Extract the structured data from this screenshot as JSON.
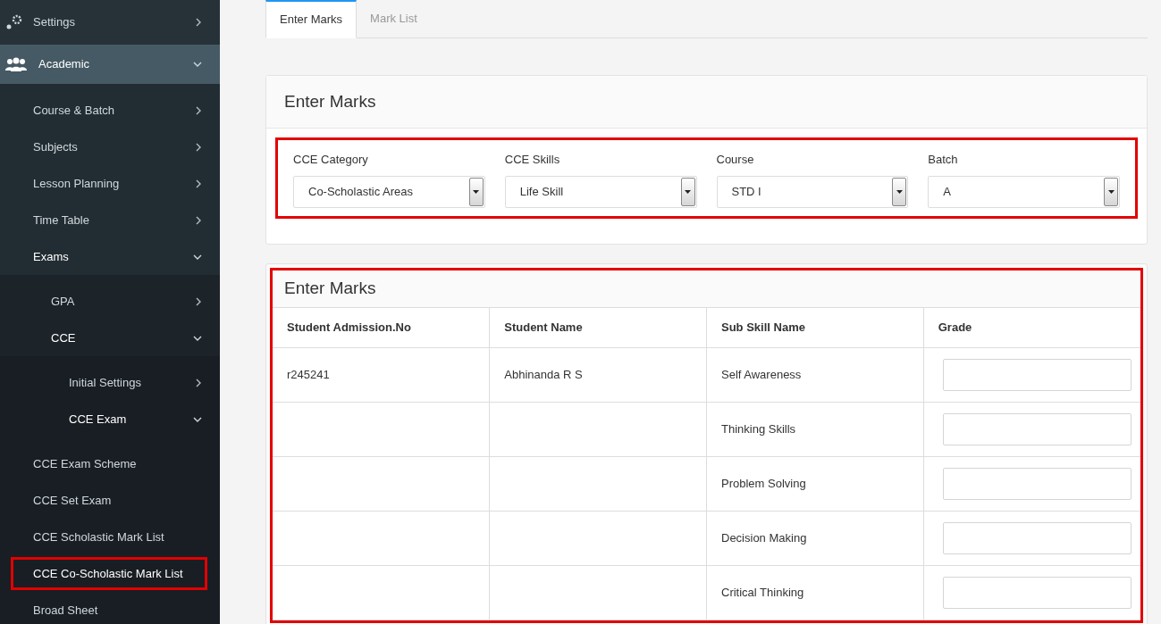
{
  "sidebar": {
    "items": [
      {
        "label": "Settings",
        "kind": "settings",
        "expanded": false
      },
      {
        "label": "Academic",
        "kind": "people",
        "expanded": true,
        "children": [
          {
            "label": "Course & Batch",
            "expanded": false
          },
          {
            "label": "Subjects",
            "expanded": false
          },
          {
            "label": "Lesson Planning",
            "expanded": false
          },
          {
            "label": "Time Table",
            "expanded": false
          },
          {
            "label": "Exams",
            "expanded": true,
            "children": [
              {
                "label": "GPA",
                "expanded": false
              },
              {
                "label": "CCE",
                "expanded": true,
                "children": [
                  {
                    "label": "Initial Settings",
                    "expanded": false
                  },
                  {
                    "label": "CCE Exam",
                    "expanded": true,
                    "children": [
                      {
                        "label": "CCE Exam Scheme",
                        "annotated": false
                      },
                      {
                        "label": "CCE Set Exam",
                        "annotated": false
                      },
                      {
                        "label": "CCE Scholastic Mark List",
                        "annotated": false
                      },
                      {
                        "label": "CCE Co-Scholastic Mark List",
                        "annotated": true
                      },
                      {
                        "label": "Broad Sheet",
                        "annotated": false
                      }
                    ]
                  }
                ]
              }
            ]
          }
        ]
      }
    ]
  },
  "tabs": [
    {
      "label": "Enter Marks",
      "selected": true
    },
    {
      "label": "Mark List",
      "selected": false
    }
  ],
  "filter_panel": {
    "title": "Enter Marks",
    "annotated": true,
    "fields": [
      {
        "label": "CCE Category",
        "value": "Co-Scholastic Areas"
      },
      {
        "label": "CCE Skills",
        "value": "Life Skill"
      },
      {
        "label": "Course",
        "value": "STD I"
      },
      {
        "label": "Batch",
        "value": "A"
      }
    ]
  },
  "marks_panel": {
    "title": "Enter Marks",
    "annotated": true,
    "columns": [
      "Student Admission.No",
      "Student Name",
      "Sub Skill Name",
      "Grade"
    ],
    "rows": [
      {
        "admission_no": "r245241",
        "name": "Abhinanda R S",
        "sub_skill": "Self Awareness"
      },
      {
        "sub_skill": "Thinking Skills"
      },
      {
        "sub_skill": "Problem Solving"
      },
      {
        "sub_skill": "Decision Making"
      },
      {
        "sub_skill": "Critical Thinking"
      }
    ]
  }
}
